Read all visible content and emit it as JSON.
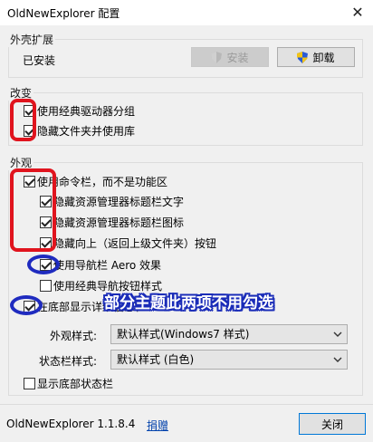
{
  "window": {
    "title": "OldNewExplorer 配置",
    "close_glyph": "✕"
  },
  "shell_ext": {
    "group_title": "外壳扩展",
    "status": "已安装",
    "install_label": "安装",
    "uninstall_label": "卸载"
  },
  "changes": {
    "group_title": "改变",
    "items": [
      {
        "label": "使用经典驱动器分组",
        "checked": true
      },
      {
        "label": "隐藏文件夹并使用库",
        "checked": true
      }
    ]
  },
  "appearance": {
    "group_title": "外观",
    "items": [
      {
        "label": "使用命令栏，而不是功能区",
        "checked": true
      },
      {
        "label": "隐藏资源管理器标题栏文字",
        "checked": true
      },
      {
        "label": "隐藏资源管理器标题栏图标",
        "checked": true
      },
      {
        "label": "隐藏向上（返回上级文件夹）按钮",
        "checked": true
      },
      {
        "label": "使用导航栏 Aero 效果",
        "checked": true
      },
      {
        "label": "使用经典导航按钮样式",
        "checked": false
      },
      {
        "label": "在底部显示详细信息栏",
        "checked": true
      }
    ],
    "style_label": "外观样式:",
    "style_value": "默认样式(Windows7 样式)",
    "statusbar_label": "状态栏样式:",
    "statusbar_value": "默认样式 (白色)",
    "show_statusbar": {
      "label": "显示底部状态栏",
      "checked": false
    }
  },
  "annotation": {
    "text": "部分主题此两项不用勾选"
  },
  "footer": {
    "version": "OldNewExplorer 1.1.8.4",
    "donate_label": "捐赠",
    "close_label": "关闭"
  }
}
